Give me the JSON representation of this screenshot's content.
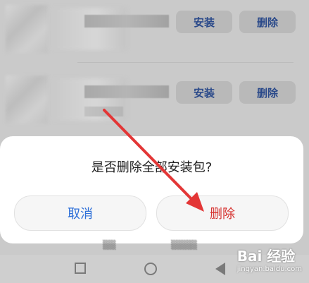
{
  "list": {
    "rows": [
      {
        "install_label": "安装",
        "delete_label": "删除"
      },
      {
        "install_label": "安装",
        "delete_label": "删除"
      }
    ]
  },
  "dialog": {
    "title": "是否删除全部安装包?",
    "cancel_label": "取消",
    "confirm_label": "删除"
  },
  "colors": {
    "cancel_text": "#2d6fd8",
    "confirm_text": "#d6322f",
    "annotation_arrow": "#e33636"
  },
  "watermark": {
    "brand": "Bai 经验",
    "url": "jingyan.baidu.com"
  },
  "icons": [
    "square-icon",
    "home-circle-icon",
    "back-triangle-icon",
    "arrow-annotation"
  ]
}
